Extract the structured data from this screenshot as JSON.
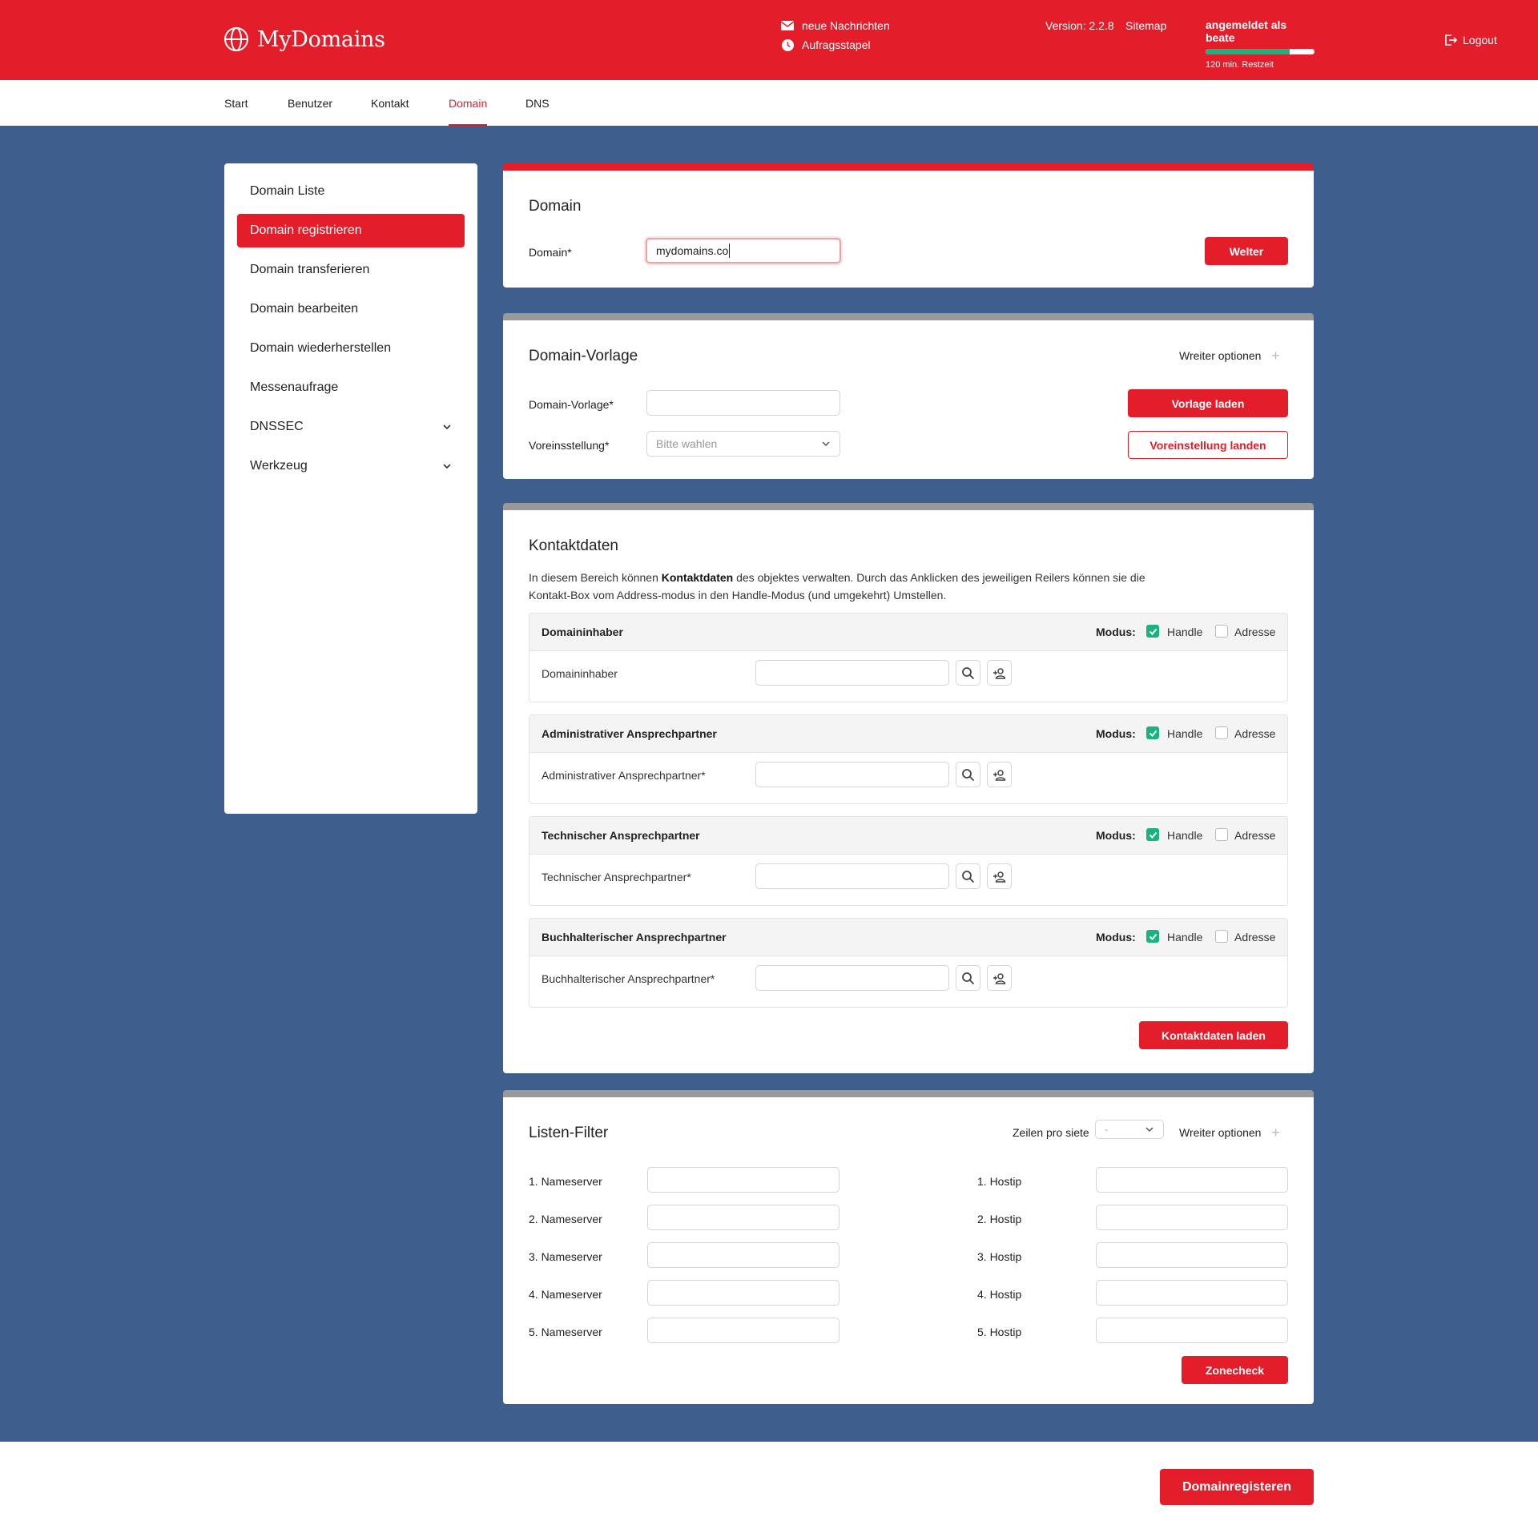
{
  "header": {
    "brand": "MyDomains",
    "messages_label": "neue Nachrichten",
    "queue_label": "Aufragsstapel",
    "version_label": "Version: 2.2.8",
    "sitemap_label": "Sitemap",
    "user_label": "angemeldet als beate",
    "session_remaining_fraction": 0.77,
    "session_time": "120 min. Restzeit",
    "logout_label": "Logout",
    "brand_color": "#e31e2a"
  },
  "nav": {
    "items": [
      "Start",
      "Benutzer",
      "Kontakt",
      "Domain",
      "DNS"
    ],
    "active": "Domain"
  },
  "sidebar": {
    "items": [
      {
        "label": "Domain Liste"
      },
      {
        "label": "Domain registrieren",
        "active": true
      },
      {
        "label": "Domain transferieren"
      },
      {
        "label": "Domain bearbeiten"
      },
      {
        "label": "Domain wiederherstellen"
      },
      {
        "label": "Messenaufrage"
      },
      {
        "label": "DNSSEC",
        "icon": "chevron-down-icon"
      },
      {
        "label": "Werkzeug",
        "icon": "chevron-down-icon"
      }
    ]
  },
  "domain_panel": {
    "title": "Domain",
    "field_label": "Domain*",
    "field_value": "mydomains.co",
    "button": "Welter"
  },
  "template_panel": {
    "title": "Domain-Vorlage",
    "more_label": "Wreiter optionen",
    "vorlage_label": "Domain-Vorlage*",
    "vorlage_value": "",
    "preset_label": "Voreinsstellung*",
    "preset_placeholder": "Bitte wahlen",
    "load_button": "Vorlage laden",
    "preset_button": "Voreinstellung landen"
  },
  "contacts_panel": {
    "title": "Kontaktdaten",
    "desc_pre": "In diesem Bereich können ",
    "desc_bold": "Kontaktdaten",
    "desc_post": " des objektes verwalten. Durch das Anklicken des jeweiligen Reilers können sie die",
    "desc_line2": "Kontakt-Box  vom Address-modus in den Handle-Modus (und umgekehrt) Umstellen.",
    "modus_label": "Modus:",
    "handle_label": "Handle",
    "address_label": "Adresse",
    "boxes": [
      {
        "title": "Domaininhaber",
        "field_label": "Domaininhaber",
        "handle": true,
        "address": false
      },
      {
        "title": "Administrativer Ansprechpartner",
        "field_label": "Administrativer Ansprechpartner*",
        "handle": true,
        "address": false
      },
      {
        "title": "Technischer Ansprechpartner",
        "field_label": "Technischer Ansprechpartner*",
        "handle": true,
        "address": false
      },
      {
        "title": "Buchhalterischer Ansprechpartner",
        "field_label": "Buchhalterischer Ansprechpartner*",
        "handle": true,
        "address": false
      }
    ],
    "load_button": "Kontaktdaten laden"
  },
  "filter_panel": {
    "title": "Listen-Filter",
    "rows_label": "Zeilen pro siete",
    "rows_value": "-",
    "more_label": "Wreiter optionen",
    "nameservers": [
      "1. Nameserver",
      "2. Nameserver",
      "3. Nameserver",
      "4. Nameserver",
      "5. Nameserver"
    ],
    "hostips": [
      "1. Hostip",
      "2. Hostip",
      "3. Hostip",
      "4. Hostip",
      "5. Hostip"
    ],
    "zonecheck_button": "Zonecheck"
  },
  "footer": {
    "register_button": "Domainregisteren"
  }
}
